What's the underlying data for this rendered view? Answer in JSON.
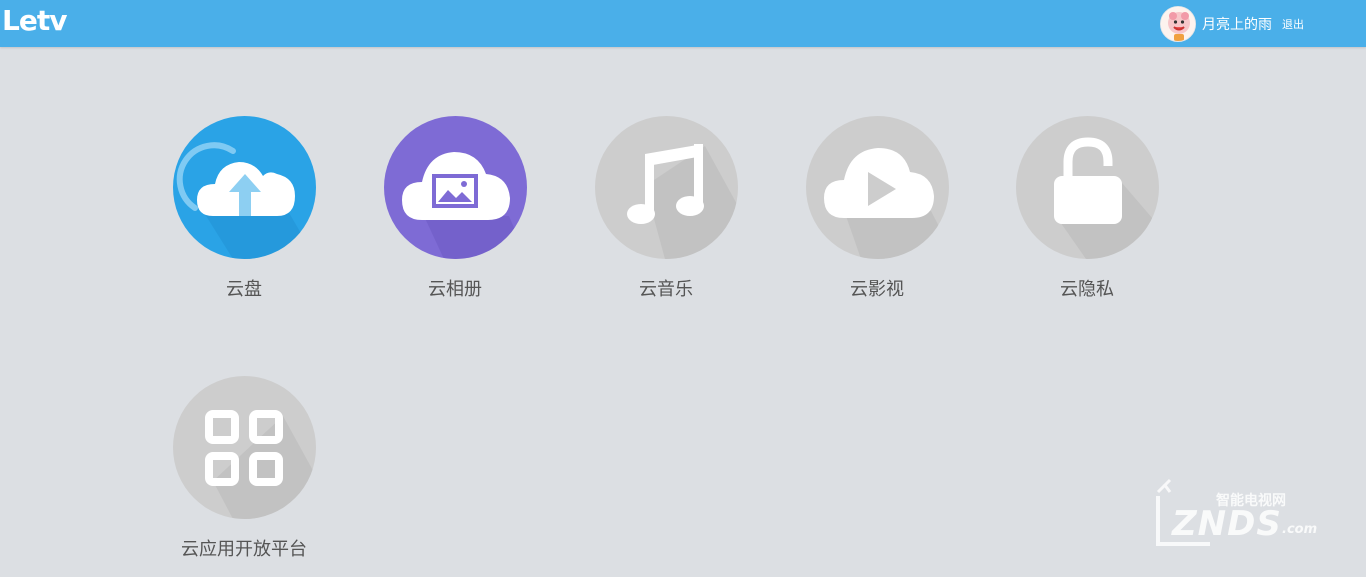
{
  "header": {
    "logo_text": "Letv",
    "username": "月亮上的雨",
    "logout_label": "退出"
  },
  "apps": [
    {
      "label": "云盘",
      "icon": "cloud-upload-icon",
      "color": "#2aa3e6"
    },
    {
      "label": "云相册",
      "icon": "cloud-photo-icon",
      "color": "#7e6bd5"
    },
    {
      "label": "云音乐",
      "icon": "music-note-icon",
      "color": "#cdcdcd"
    },
    {
      "label": "云影视",
      "icon": "cloud-play-icon",
      "color": "#cdcdcd"
    },
    {
      "label": "云隐私",
      "icon": "padlock-icon",
      "color": "#cdcdcd"
    },
    {
      "label": "云应用开放平台",
      "icon": "grid-apps-icon",
      "color": "#cdcdcd"
    }
  ],
  "watermark": {
    "cn_text": "智能电视网",
    "en_text": "ZNDS",
    "suffix": ".com"
  }
}
